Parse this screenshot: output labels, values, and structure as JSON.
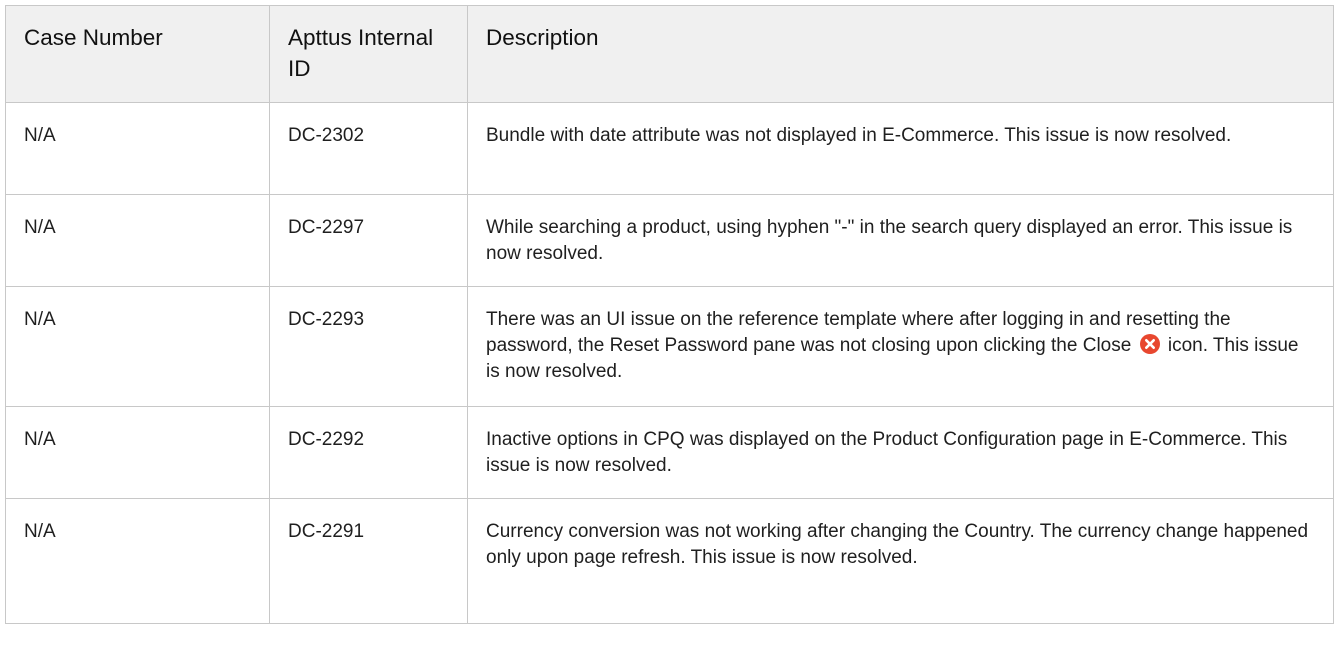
{
  "table": {
    "headers": {
      "case_number": "Case Number",
      "internal_id": "Apttus Internal ID",
      "description": "Description"
    },
    "rows": [
      {
        "case_number": "N/A",
        "internal_id": "DC-2302",
        "description": "Bundle with date attribute was not displayed in E-Commerce. This issue is now resolved."
      },
      {
        "case_number": "N/A",
        "internal_id": "DC-2297",
        "description": "While searching a product, using hyphen \"-\" in the search query displayed an error. This issue is now resolved."
      },
      {
        "case_number": "N/A",
        "internal_id": "DC-2293",
        "description_before_icon": "There was an UI issue on the reference template where after logging in and resetting the password, the Reset Password pane was not closing upon clicking the Close",
        "description_icon": "close-circle-icon",
        "description_after_icon": "icon. This issue is now resolved."
      },
      {
        "case_number": "N/A",
        "internal_id": "DC-2292",
        "description": "Inactive options in CPQ was displayed on the Product Configuration page in E-Commerce. This issue is now resolved."
      },
      {
        "case_number": "N/A",
        "internal_id": "DC-2291",
        "description": "Currency conversion was not working after changing the Country. The currency change happened only upon page refresh. This issue is now resolved."
      }
    ]
  },
  "colors": {
    "header_bg": "#f0f0f0",
    "border": "#c8c8c8",
    "close_icon": "#e8472f"
  }
}
